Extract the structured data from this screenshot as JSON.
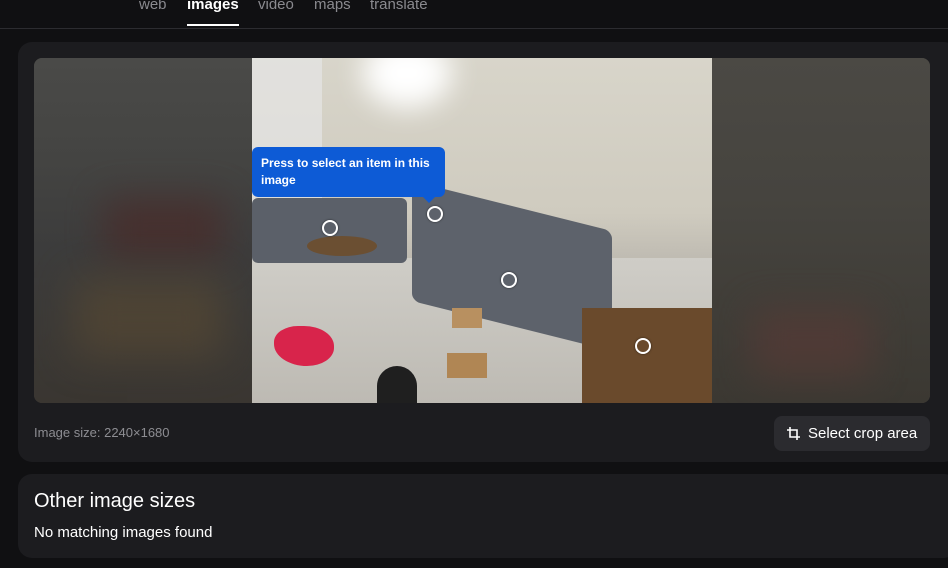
{
  "tabs": [
    {
      "label": "web"
    },
    {
      "label": "images",
      "active": true
    },
    {
      "label": "video"
    },
    {
      "label": "maps"
    },
    {
      "label": "translate"
    }
  ],
  "viewer": {
    "tooltip": "Press to select an item in this image",
    "image_size_label": "Image size: 2240×1680",
    "crop_button_label": "Select crop area",
    "crop_icon": "crop-icon",
    "item_markers": 4
  },
  "other_sizes": {
    "title": "Other image sizes",
    "empty_message": "No matching images found"
  },
  "colors": {
    "background": "#101012",
    "card": "#1c1c1f",
    "tooltip": "#0d5bd6",
    "button": "#2b2b2f"
  }
}
